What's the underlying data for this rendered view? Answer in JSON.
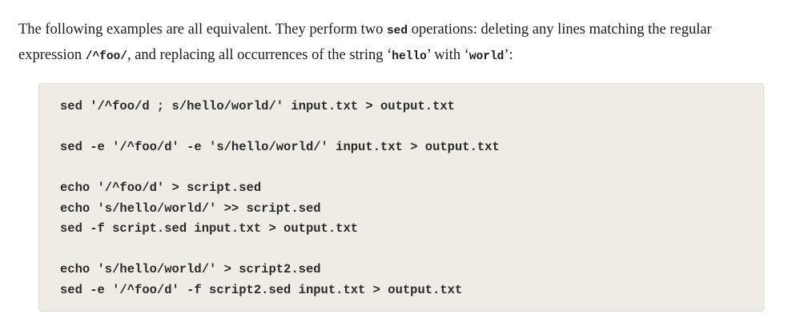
{
  "intro": {
    "part1": "The following examples are all equivalent. They perform two ",
    "code_sed": "sed",
    "part2": " operations: deleting any lines matching the regular expression ",
    "code_regex": "/^foo/",
    "part3": ", and replacing all occurrences of the string ‘",
    "code_hello": "hello",
    "part4": "’ with ‘",
    "code_world": "world",
    "part5": "’:"
  },
  "code_lines": [
    "sed '/^foo/d ; s/hello/world/' input.txt > output.txt",
    "",
    "sed -e '/^foo/d' -e 's/hello/world/' input.txt > output.txt",
    "",
    "echo '/^foo/d' > script.sed",
    "echo 's/hello/world/' >> script.sed",
    "sed -f script.sed input.txt > output.txt",
    "",
    "echo 's/hello/world/' > script2.sed",
    "sed -e '/^foo/d' -f script2.sed input.txt > output.txt"
  ]
}
